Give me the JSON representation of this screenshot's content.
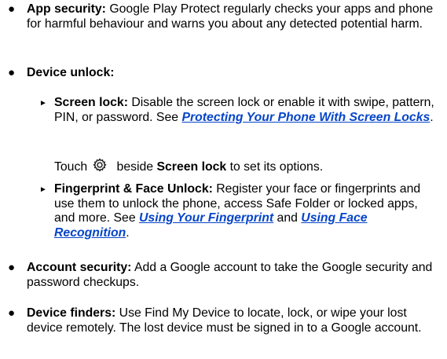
{
  "items": [
    {
      "label": "App security:",
      "text": " Google Play Protect regularly checks your apps and phone for harmful behaviour and warns you about any detected potential harm."
    },
    {
      "label": "Device unlock:"
    },
    {
      "label": "Account security:",
      "text": " Add a Google account to take the Google security and password checkups."
    },
    {
      "label": "Device finders:",
      "text": " Use Find My Device to locate, lock, or wipe your lost device remotely. The lost device must be signed in to a Google account."
    }
  ],
  "sub_items": [
    {
      "label": "Screen lock:",
      "text": " Disable the screen lock or enable it with swipe, pattern, PIN, or password. See ",
      "link": "Protecting Your Phone With Screen Locks",
      "end": "."
    },
    {
      "label": "Fingerprint & Face Unlock:",
      "text": " Register your face or fingerprints and use them to unlock the phone, access Safe Folder or locked apps, and more. See ",
      "link1": "Using Your Fingerprint",
      "mid": " and ",
      "link2": "Using Face Recognition",
      "end": "."
    }
  ],
  "touch_line": {
    "before": "Touch",
    "after": " beside ",
    "bold": "Screen lock",
    "end": " to set its options.",
    "icon": "gear-icon"
  },
  "colors": {
    "link": "#0645c8"
  }
}
